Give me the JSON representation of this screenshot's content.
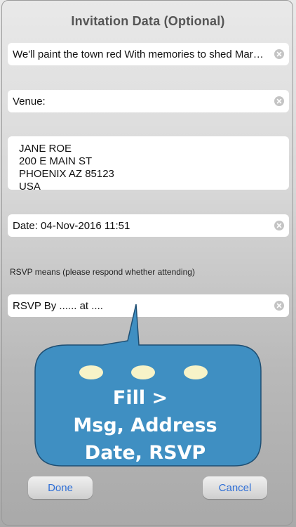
{
  "title": "Invitation Data (Optional)",
  "message_field": {
    "value": "We'll paint the town red With memories to shed Mar…"
  },
  "venue_field": {
    "value": "Venue:"
  },
  "address": {
    "lines": [
      "JANE ROE",
      "200 E MAIN ST",
      "PHOENIX AZ 85123",
      "USA"
    ]
  },
  "date_field": {
    "value": "Date: 04-Nov-2016 11:51"
  },
  "rsvp_note": "RSVP means (please respond whether attending)",
  "rsvp_field": {
    "value": "RSVP By ...... at ...."
  },
  "callout": {
    "lines": [
      "Fill >",
      "Msg, Address",
      "Date, RSVP"
    ],
    "color": "#3f8fc2"
  },
  "buttons": {
    "done": "Done",
    "cancel": "Cancel"
  },
  "colors": {
    "button_text": "#2f6fd6",
    "clear_icon": "#c4c4c4"
  }
}
